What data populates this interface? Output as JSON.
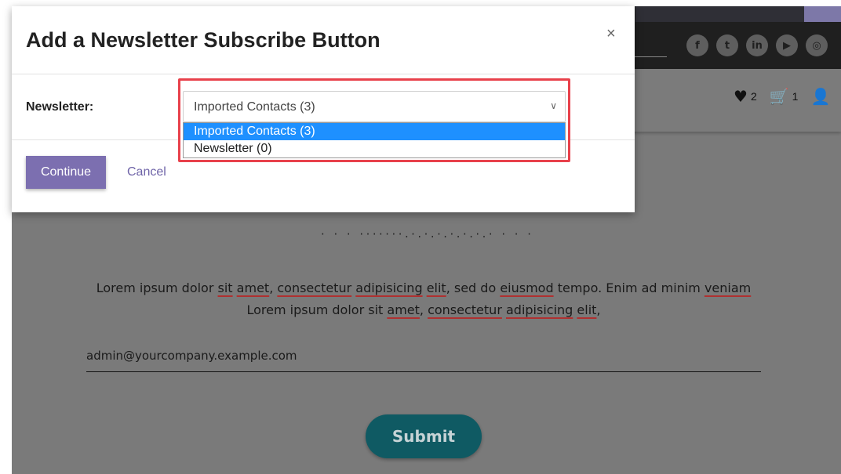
{
  "modal": {
    "title": "Add a Newsletter Subscribe Button",
    "close_label": "×",
    "newsletter_label": "Newsletter:",
    "selected_value": "Imported Contacts (3)",
    "options": [
      "Imported Contacts (3)",
      "Newsletter (0)"
    ],
    "continue_label": "Continue",
    "cancel_label": "Cancel"
  },
  "header": {
    "social_icons": [
      "facebook-icon",
      "twitter-icon",
      "linkedin-icon",
      "youtube-icon",
      "instagram-icon"
    ],
    "social_glyphs": [
      "f",
      "t",
      "in",
      "▶",
      "◎"
    ],
    "wishlist_count": "2",
    "cart_count": "1"
  },
  "content": {
    "dots": "· · · ·······.·.·.·.·.·.·.· · · ·",
    "email_value": "admin@yourcompany.example.com",
    "submit_label": "Submit"
  },
  "colors": {
    "accent": "#7c6fb0",
    "selected_option": "#1e90ff",
    "highlight_border": "#e8414b",
    "submit_bg": "#0f5a63"
  }
}
